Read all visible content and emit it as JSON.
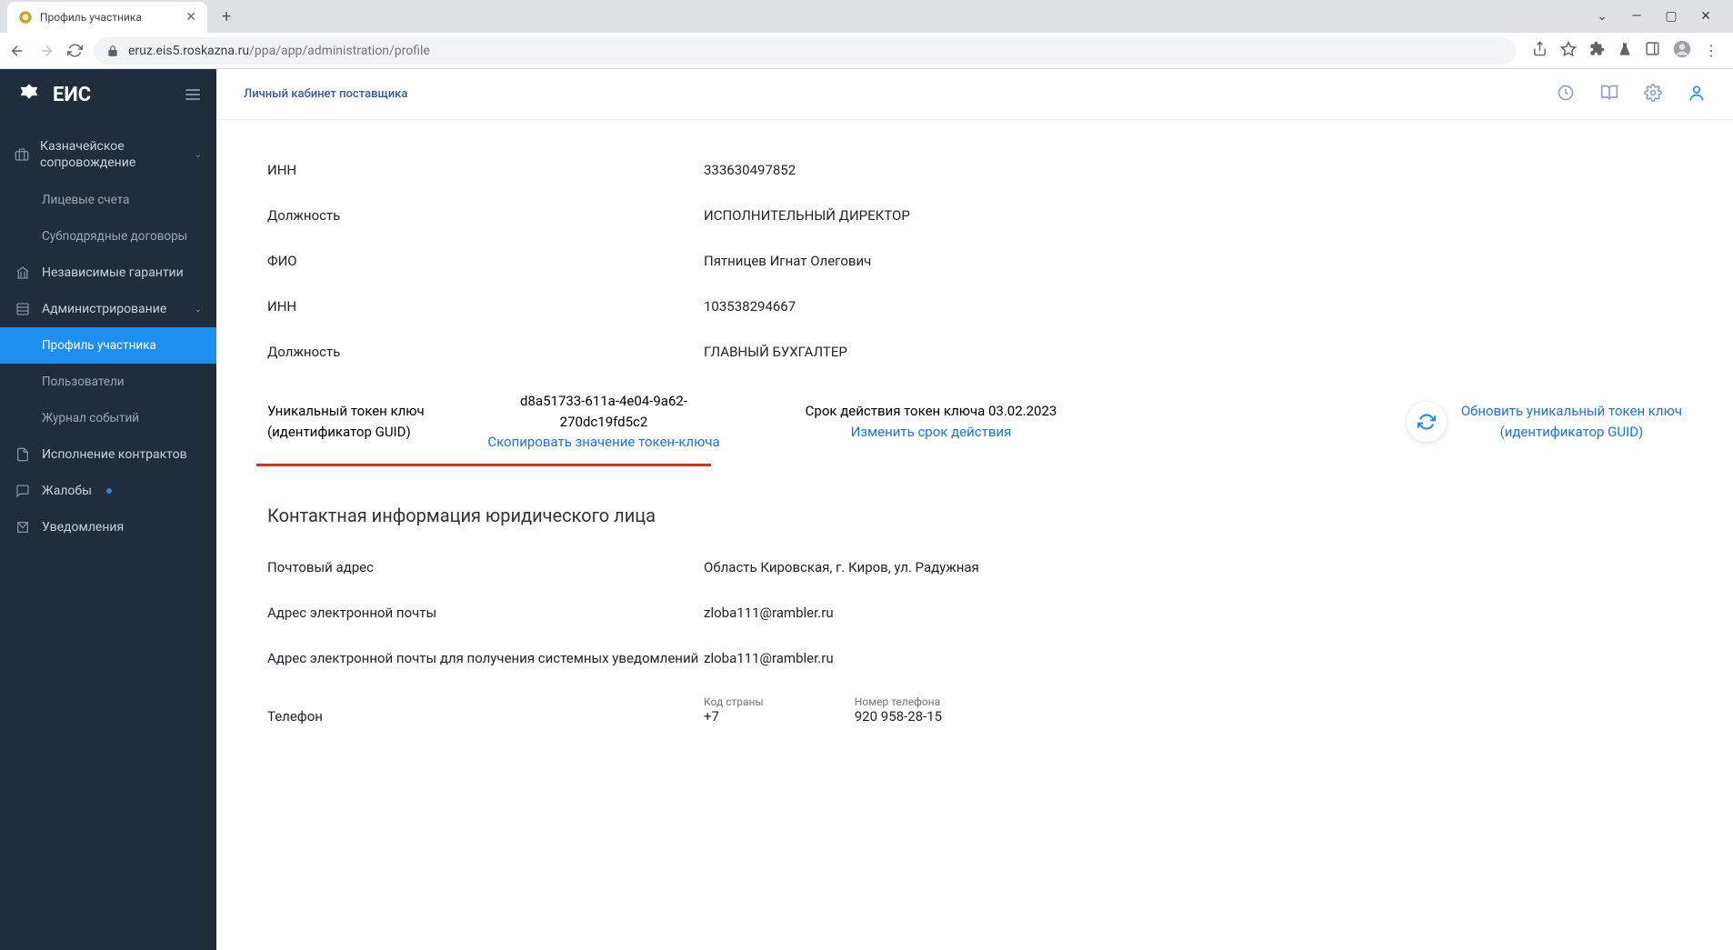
{
  "browser": {
    "tab_title": "Профиль участника",
    "url_host": "eruz.eis5.roskazna.ru",
    "url_path": "/ppa/app/administration/profile"
  },
  "sidebar": {
    "logo": "ЕИС",
    "items": [
      {
        "label": "Казначейское сопровождение",
        "chev": true
      },
      {
        "label": "Лицевые счета",
        "sub": true
      },
      {
        "label": "Субподрядные договоры",
        "sub": true
      },
      {
        "label": "Независимые гарантии"
      },
      {
        "label": "Администрирование",
        "chev": true
      },
      {
        "label": "Профиль участника",
        "sub": true,
        "active": true
      },
      {
        "label": "Пользователи",
        "sub": true
      },
      {
        "label": "Журнал событий",
        "sub": true
      },
      {
        "label": "Исполнение контрактов"
      },
      {
        "label": "Жалобы",
        "dot": true
      },
      {
        "label": "Уведомления"
      }
    ]
  },
  "topbar": {
    "title": "Личный кабинет поставщика"
  },
  "fields": {
    "inn1_label": "ИНН",
    "inn1_value": "333630497852",
    "pos1_label": "Должность",
    "pos1_value": "ИСПОЛНИТЕЛЬНЫЙ ДИРЕКТОР",
    "fio_label": "ФИО",
    "fio_value": "Пятницев Игнат Олегович",
    "inn2_label": "ИНН",
    "inn2_value": "103538294667",
    "pos2_label": "Должность",
    "pos2_value": "ГЛАВНЫЙ БУХГАЛТЕР"
  },
  "token": {
    "col1_l1": "Уникальный токен ключ",
    "col1_l2": "(идентификатор GUID)",
    "guid": "d8a51733-611a-4e04-9a62-270dc19fd5c2",
    "copy": "Скопировать значение токен-ключа",
    "expiry_prefix": "Срок действия токен ключа ",
    "expiry_date": "03.02.2023",
    "change": "Изменить срок действия",
    "refresh_l1": "Обновить уникальный токен ключ",
    "refresh_l2": "(идентификатор GUID)"
  },
  "contact": {
    "section": "Контактная информация юридического лица",
    "post_label": "Почтовый адрес",
    "post_value": "Область Кировская, г. Киров,  ул. Радужная",
    "email_label": "Адрес электронной почты",
    "email_value": "zloba111@rambler.ru",
    "sys_label": "Адрес электронной почты для получения системных уведомлений",
    "sys_value": "zloba111@rambler.ru",
    "phone_label": "Телефон",
    "code_label": "Код страны",
    "code_value": "+7",
    "num_label": "Номер телефона",
    "num_value": "920 958-28-15"
  }
}
